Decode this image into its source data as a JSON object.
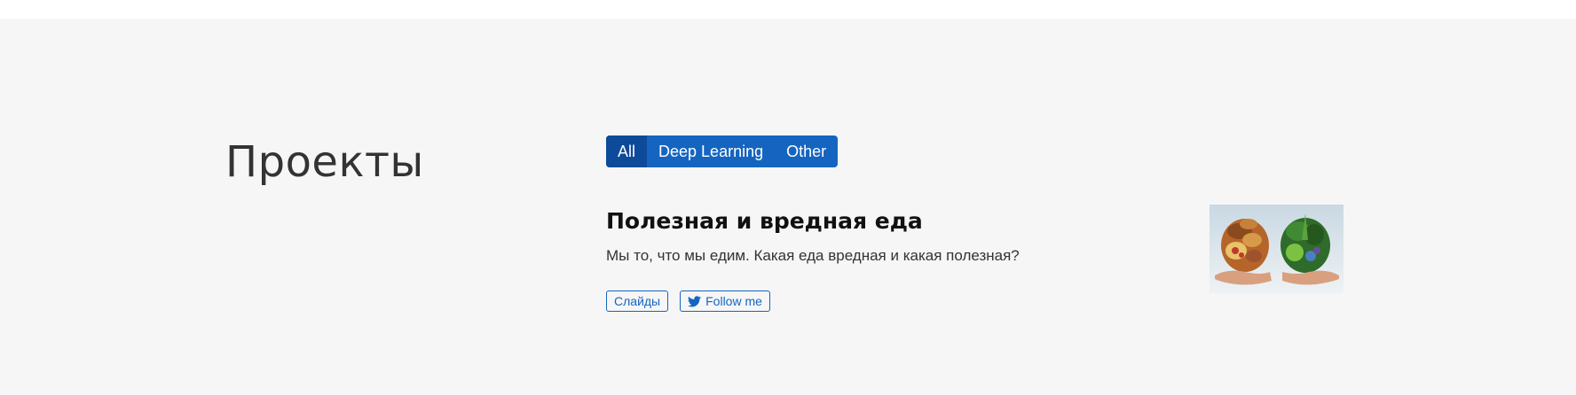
{
  "section": {
    "title": "Проекты"
  },
  "filters": {
    "items": [
      {
        "label": "All",
        "active": true
      },
      {
        "label": "Deep Learning",
        "active": false
      },
      {
        "label": "Other",
        "active": false
      }
    ]
  },
  "project": {
    "title": "Полезная и вредная еда",
    "description": "Мы то, что мы едим. Какая еда вредная и какая полезная?",
    "slides_label": "Слайды",
    "follow_label": "Follow me",
    "follow_icon": "twitter-icon",
    "thumbnail_icon": "food-comparison-image"
  },
  "colors": {
    "accent": "#1565c0",
    "accent_active": "#0d4a99",
    "section_bg": "#f6f6f6"
  }
}
